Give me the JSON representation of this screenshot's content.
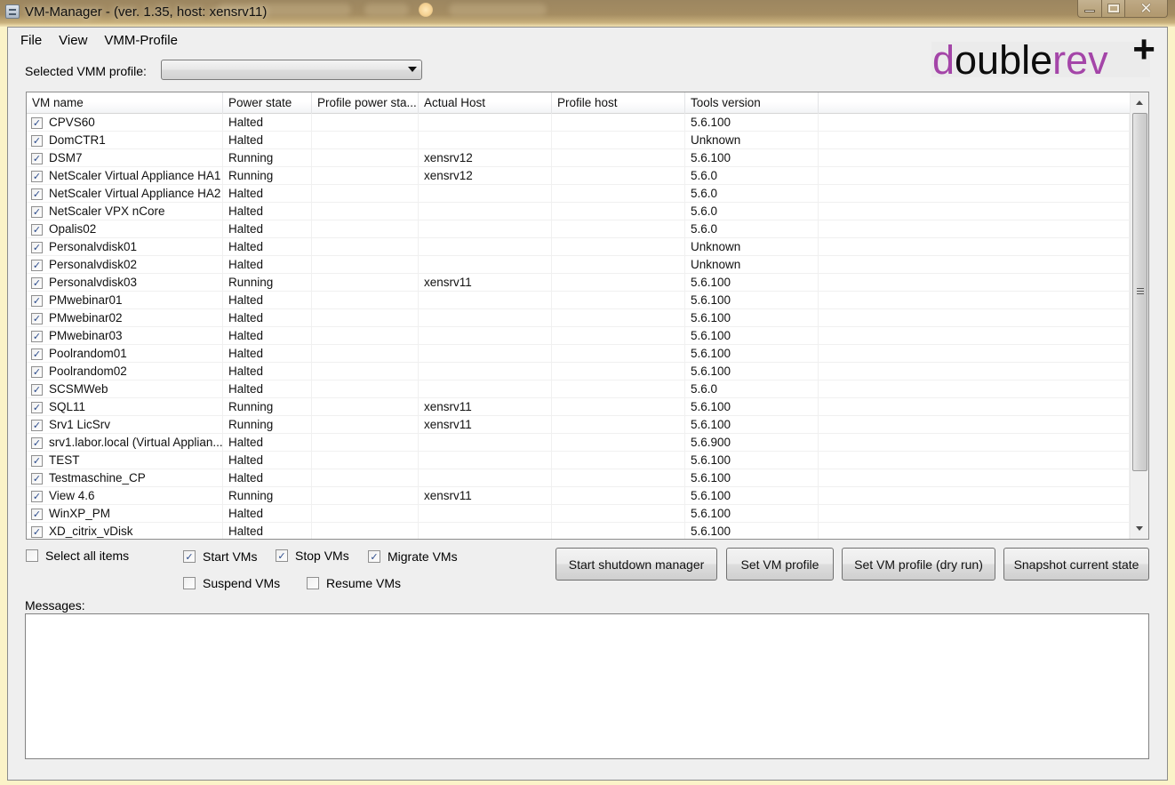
{
  "window": {
    "title": "VM-Manager - (ver. 1.35, host: xensrv11)",
    "controls": {
      "minimize": "minimize",
      "maximize": "maximize",
      "close": "close"
    }
  },
  "menu": [
    {
      "label": "File"
    },
    {
      "label": "View"
    },
    {
      "label": "VMM-Profile"
    }
  ],
  "profile": {
    "label": "Selected VMM profile:",
    "selected_value": ""
  },
  "logo": {
    "part1": "d",
    "part2": "ouble",
    "part3": "rev",
    "plus": "+",
    "colors": {
      "accent": "#a445a8",
      "dark": "#0d0d0d"
    }
  },
  "table": {
    "columns": [
      "VM name",
      "Power state",
      "Profile power sta...",
      "Actual Host",
      "Profile host",
      "Tools version",
      ""
    ],
    "rows": [
      {
        "checked": true,
        "name": "CPVS60",
        "power": "Halted",
        "profile_power": "",
        "actual_host": "",
        "profile_host": "",
        "tools": "5.6.100"
      },
      {
        "checked": true,
        "name": "DomCTR1",
        "power": "Halted",
        "profile_power": "",
        "actual_host": "",
        "profile_host": "",
        "tools": "Unknown"
      },
      {
        "checked": true,
        "name": "DSM7",
        "power": "Running",
        "profile_power": "",
        "actual_host": "xensrv12",
        "profile_host": "",
        "tools": "5.6.100"
      },
      {
        "checked": true,
        "name": "NetScaler Virtual Appliance HA1",
        "power": "Running",
        "profile_power": "",
        "actual_host": "xensrv12",
        "profile_host": "",
        "tools": "5.6.0"
      },
      {
        "checked": true,
        "name": "NetScaler Virtual Appliance HA2",
        "power": "Halted",
        "profile_power": "",
        "actual_host": "",
        "profile_host": "",
        "tools": "5.6.0"
      },
      {
        "checked": true,
        "name": "NetScaler VPX nCore",
        "power": "Halted",
        "profile_power": "",
        "actual_host": "",
        "profile_host": "",
        "tools": "5.6.0"
      },
      {
        "checked": true,
        "name": "Opalis02",
        "power": "Halted",
        "profile_power": "",
        "actual_host": "",
        "profile_host": "",
        "tools": "5.6.0"
      },
      {
        "checked": true,
        "name": "Personalvdisk01",
        "power": "Halted",
        "profile_power": "",
        "actual_host": "",
        "profile_host": "",
        "tools": "Unknown"
      },
      {
        "checked": true,
        "name": "Personalvdisk02",
        "power": "Halted",
        "profile_power": "",
        "actual_host": "",
        "profile_host": "",
        "tools": "Unknown"
      },
      {
        "checked": true,
        "name": "Personalvdisk03",
        "power": "Running",
        "profile_power": "",
        "actual_host": "xensrv11",
        "profile_host": "",
        "tools": "5.6.100"
      },
      {
        "checked": true,
        "name": "PMwebinar01",
        "power": "Halted",
        "profile_power": "",
        "actual_host": "",
        "profile_host": "",
        "tools": "5.6.100"
      },
      {
        "checked": true,
        "name": "PMwebinar02",
        "power": "Halted",
        "profile_power": "",
        "actual_host": "",
        "profile_host": "",
        "tools": "5.6.100"
      },
      {
        "checked": true,
        "name": "PMwebinar03",
        "power": "Halted",
        "profile_power": "",
        "actual_host": "",
        "profile_host": "",
        "tools": "5.6.100"
      },
      {
        "checked": true,
        "name": "Poolrandom01",
        "power": "Halted",
        "profile_power": "",
        "actual_host": "",
        "profile_host": "",
        "tools": "5.6.100"
      },
      {
        "checked": true,
        "name": "Poolrandom02",
        "power": "Halted",
        "profile_power": "",
        "actual_host": "",
        "profile_host": "",
        "tools": "5.6.100"
      },
      {
        "checked": true,
        "name": "SCSMWeb",
        "power": "Halted",
        "profile_power": "",
        "actual_host": "",
        "profile_host": "",
        "tools": "5.6.0"
      },
      {
        "checked": true,
        "name": "SQL11",
        "power": "Running",
        "profile_power": "",
        "actual_host": "xensrv11",
        "profile_host": "",
        "tools": "5.6.100"
      },
      {
        "checked": true,
        "name": "Srv1 LicSrv",
        "power": "Running",
        "profile_power": "",
        "actual_host": "xensrv11",
        "profile_host": "",
        "tools": "5.6.100"
      },
      {
        "checked": true,
        "name": "srv1.labor.local (Virtual Applian...",
        "power": "Halted",
        "profile_power": "",
        "actual_host": "",
        "profile_host": "",
        "tools": "5.6.900"
      },
      {
        "checked": true,
        "name": "TEST",
        "power": "Halted",
        "profile_power": "",
        "actual_host": "",
        "profile_host": "",
        "tools": "5.6.100"
      },
      {
        "checked": true,
        "name": "Testmaschine_CP",
        "power": "Halted",
        "profile_power": "",
        "actual_host": "",
        "profile_host": "",
        "tools": "5.6.100"
      },
      {
        "checked": true,
        "name": "View 4.6",
        "power": "Running",
        "profile_power": "",
        "actual_host": "xensrv11",
        "profile_host": "",
        "tools": "5.6.100"
      },
      {
        "checked": true,
        "name": "WinXP_PM",
        "power": "Halted",
        "profile_power": "",
        "actual_host": "",
        "profile_host": "",
        "tools": "5.6.100"
      },
      {
        "checked": true,
        "name": "XD_citrix_vDisk",
        "power": "Halted",
        "profile_power": "",
        "actual_host": "",
        "profile_host": "",
        "tools": "5.6.100"
      }
    ]
  },
  "options": {
    "select_all": {
      "label": "Select all items",
      "checked": false
    },
    "start_vms": {
      "label": "Start VMs",
      "checked": true
    },
    "stop_vms": {
      "label": "Stop VMs",
      "checked": true
    },
    "migrate_vms": {
      "label": "Migrate VMs",
      "checked": true
    },
    "suspend_vms": {
      "label": "Suspend VMs",
      "checked": false
    },
    "resume_vms": {
      "label": "Resume VMs",
      "checked": false
    }
  },
  "buttons": {
    "start_shutdown_manager": "Start shutdown manager",
    "set_vm_profile": "Set VM profile",
    "set_vm_profile_dry_run": "Set VM profile (dry run)",
    "snapshot_current_state": "Snapshot current state"
  },
  "messages": {
    "label": "Messages:",
    "content": ""
  }
}
